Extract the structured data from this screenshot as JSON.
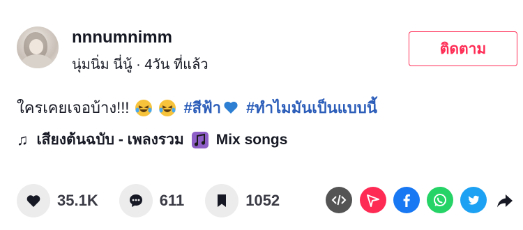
{
  "author": {
    "username": "nnnumnimm",
    "display_name": "นุ่มนิ่ม นี่นู้",
    "separator": " · ",
    "posted": "4วัน ที่แล้ว"
  },
  "follow_label": "ติดตาม",
  "caption": {
    "text": "ใครเคยเจอบ้าง!!!",
    "emoji": "rolling-on-floor-laughing",
    "hashtag1": "#สีฟ้า",
    "hashtag1_emoji": "blue-heart",
    "hashtag2": "#ทำไมมันเป็นแบบนี้"
  },
  "music": {
    "note": "♫",
    "title": "เสียงต้นฉบับ - เพลงรวม",
    "icon": "music-disc",
    "suffix": "Mix songs"
  },
  "stats": {
    "likes": "35.1K",
    "comments": "611",
    "saves": "1052"
  },
  "share_targets": [
    "embed",
    "direct-message",
    "facebook",
    "whatsapp",
    "twitter",
    "share-more"
  ],
  "colors": {
    "accent": "#fe2c55",
    "hashtag": "#2b5db9",
    "embed": "#545454",
    "dm": "#fe2c55",
    "facebook": "#1877f2",
    "whatsapp": "#25d366",
    "twitter": "#1da1f2"
  }
}
